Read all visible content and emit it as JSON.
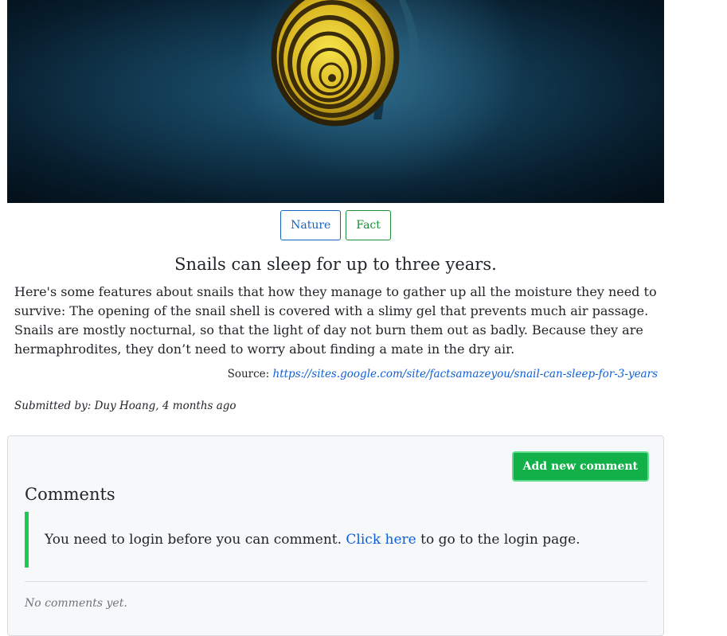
{
  "tags": [
    {
      "label": "Nature",
      "color": "#1565c0"
    },
    {
      "label": "Fact",
      "color": "#1e8f3a"
    }
  ],
  "post": {
    "title": "Snails can sleep for up to three years.",
    "body": "Here's some features about snails that how they manage to gather up all the moisture they need to survive: The opening of the snail shell is covered with a slimy gel that prevents much air passage. Snails are mostly nocturnal, so that the light of day not burn them out as badly. Because they are hermaphrodites, they don’t need to worry about finding a mate in the dry air.",
    "source_label": "Source:",
    "source_url": "https://sites.google.com/site/factsamazeyou/snail-can-sleep-for-3-years",
    "submitted": "Submitted by: Duy Hoang, 4 months ago"
  },
  "comments": {
    "add_button": "Add new comment",
    "heading": "Comments",
    "login_prefix": "You need to login before you can comment.",
    "login_link": "Click here",
    "login_suffix": "to go to the login page.",
    "empty": "No comments yet."
  },
  "colors": {
    "accent_green": "#12b049",
    "link_blue": "#0d5fd8",
    "notice_border": "#1fcb52"
  }
}
